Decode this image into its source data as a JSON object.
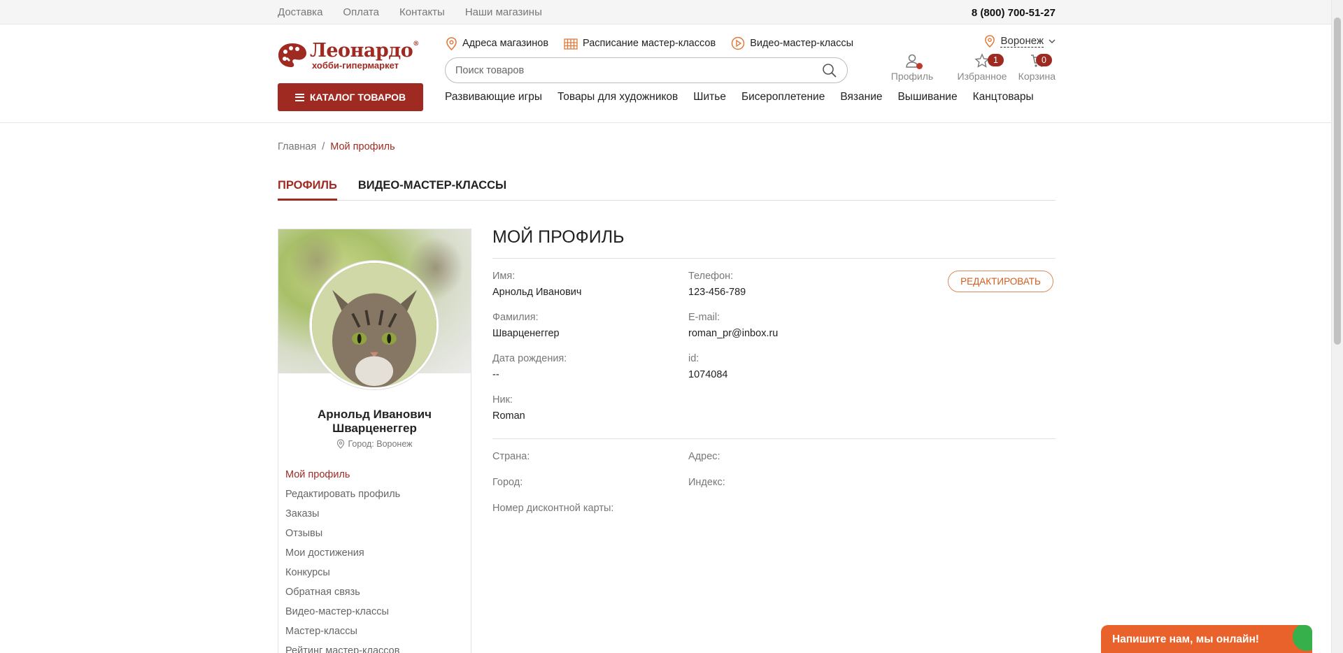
{
  "topbar": {
    "links": [
      "Доставка",
      "Оплата",
      "Контакты",
      "Наши магазины"
    ],
    "phone": "8 (800) 700-51-27"
  },
  "header": {
    "logo_name": "Леонардо",
    "logo_reg": "®",
    "logo_sub": "хобби-гипермаркет",
    "catalog_button": "КАТАЛОГ ТОВАРОВ",
    "quicklinks": [
      "Адреса магазинов",
      "Расписание мастер-классов",
      "Видео-мастер-классы"
    ],
    "search_placeholder": "Поиск товаров",
    "city": "Воронеж",
    "profile_label": "Профиль",
    "favorites_label": "Избранное",
    "favorites_count": "1",
    "cart_label": "Корзина",
    "cart_count": "0",
    "nav": [
      "Развивающие игры",
      "Товары для художников",
      "Шитье",
      "Бисероплетение",
      "Вязание",
      "Вышивание",
      "Канцтовары"
    ],
    "accent_color": "#9e2a22"
  },
  "breadcrumb": {
    "home": "Главная",
    "separator": "/",
    "current": "Мой профиль"
  },
  "tabs": [
    "ПРОФИЛЬ",
    "ВИДЕО-МАСТЕР-КЛАССЫ"
  ],
  "user_card": {
    "name_line1": "Арнольд Иванович",
    "name_line2": "Шварценеггер",
    "city": "Город: Воронеж",
    "menu": [
      "Мой профиль",
      "Редактировать профиль",
      "Заказы",
      "Отзывы",
      "Мои достижения",
      "Конкурсы",
      "Обратная связь",
      "Видео-мастер-классы",
      "Мастер-классы",
      "Рейтинг мастер-классов"
    ]
  },
  "profile": {
    "title": "МОЙ ПРОФИЛЬ",
    "edit_button": "РЕДАКТИРОВАТЬ",
    "fields": [
      {
        "label": "Имя:",
        "value": "Арнольд Иванович"
      },
      {
        "label": "Телефон:",
        "value": "123-456-789"
      },
      {
        "label": "Фамилия:",
        "value": "Шварценеггер"
      },
      {
        "label": "E-mail:",
        "value": "roman_pr@inbox.ru"
      },
      {
        "label": "Дата рождения:",
        "value": "--"
      },
      {
        "label": "id:",
        "value": "1074084"
      },
      {
        "label": "Ник:",
        "value": "Roman"
      }
    ],
    "address_fields": [
      "Страна:",
      "Адрес:",
      "Город:",
      "Индекс:",
      "Номер дисконтной карты:"
    ]
  },
  "chat": {
    "label": "Напишите нам, мы онлайн!"
  }
}
